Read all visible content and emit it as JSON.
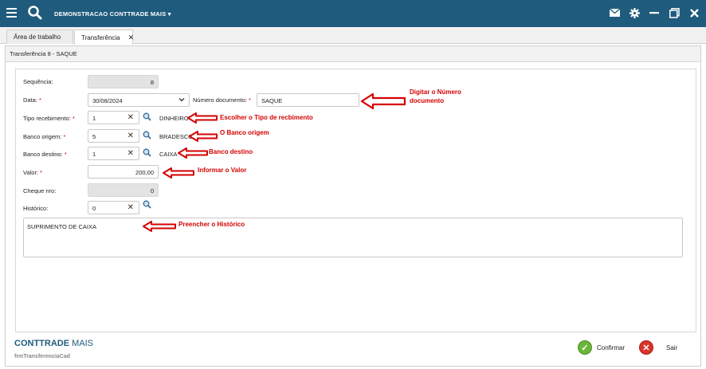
{
  "app": {
    "title": "DEMONSTRACAO CONTTRADE MAIS"
  },
  "tabs": [
    {
      "label": "Área de trabalho"
    },
    {
      "label": "Transferência"
    }
  ],
  "panel": {
    "title": "Transferência 8 - SAQUE"
  },
  "form": {
    "sequencia": {
      "label": "Sequência:",
      "value": "8"
    },
    "data": {
      "label": "Data:",
      "value": "30/08/2024"
    },
    "numero_documento": {
      "label": "Número documento:",
      "value": "SAQUE"
    },
    "tipo_recebimento": {
      "label": "Tipo recebimento:",
      "value": "1",
      "desc": "DINHEIRO"
    },
    "banco_origem": {
      "label": "Banco origem:",
      "value": "5",
      "desc": "BRADESCO"
    },
    "banco_destino": {
      "label": "Banco destino:",
      "value": "1",
      "desc": "CAIXA"
    },
    "valor": {
      "label": "Valor:",
      "value": "200,00"
    },
    "cheque_nro": {
      "label": "Cheque nro:",
      "value": "0"
    },
    "historico": {
      "label": "Histórico:",
      "value": "0",
      "text": "SUPRIMENTO DE CAIXA"
    },
    "required_mark": "*"
  },
  "annotations": {
    "numero": "Digitar o Número\ndocumento",
    "tipo": "Escolher o Tipo de recbimento",
    "origem": "O Banco origem",
    "destino": "Banco destino",
    "valor": "Informar o Valor",
    "historico": "Preencher o Histórico"
  },
  "footer": {
    "brand_main": "CONTTRADE",
    "brand_sub": "MAIS",
    "form_code": "frmTransferenciaCad",
    "confirm_label": "Confirmar",
    "exit_label": "Sair"
  },
  "colors": {
    "header": "#1f5b7c",
    "annotation": "#d40000",
    "confirm": "#6bb63a",
    "exit": "#d9342b"
  }
}
